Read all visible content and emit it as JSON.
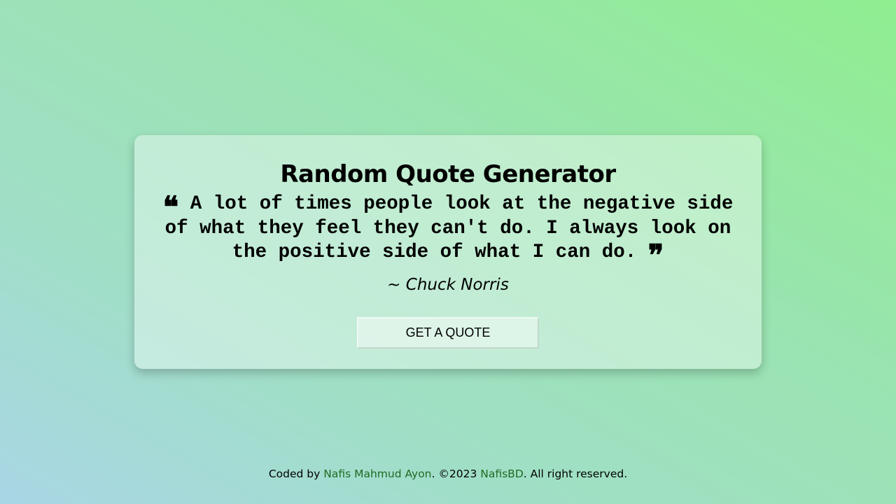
{
  "page": {
    "title": "Random Quote Generator"
  },
  "quote": {
    "open_mark": "❝",
    "text": "A lot of times people look at the negative side of what they feel they can't do. I always look on the positive side of what I can do.",
    "close_mark": "❞",
    "author": "~ Chuck Norris"
  },
  "button": {
    "label": "GET A QUOTE"
  },
  "footer": {
    "prefix": "Coded by ",
    "author_link": "Nafis Mahmud Ayon",
    "middle": ". ©2023 ",
    "brand_link": "NafisBD",
    "suffix": ". All right reserved."
  },
  "colors": {
    "link": "#1f6b22",
    "background_start": "#a9d6e5",
    "background_end": "#90ee90"
  }
}
